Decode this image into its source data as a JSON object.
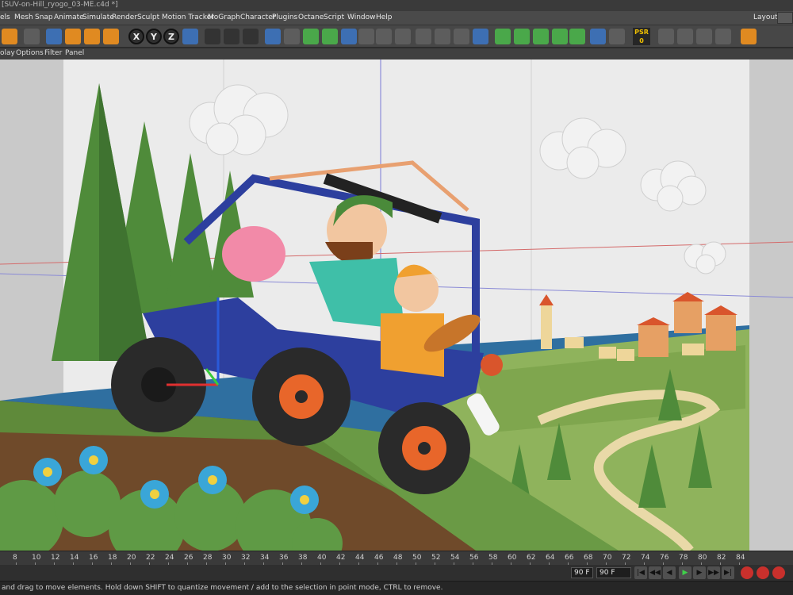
{
  "window": {
    "title": "[SUV-on-Hill_ryogo_03-ME.c4d *]"
  },
  "menu": {
    "items": [
      "els",
      "Mesh",
      "Snap",
      "Animate",
      "Simulate",
      "Render",
      "Sculpt",
      "Motion Tracker",
      "MoGraph",
      "Character",
      "Plugins",
      "Octane",
      "Script",
      "Window",
      "Help"
    ],
    "layout_label": "Layout:"
  },
  "toolbar": {
    "axis_x": "X",
    "axis_y": "Y",
    "axis_z": "Z",
    "psr_label": "PSR",
    "psr_value": "0",
    "icons": [
      "live-selection-icon",
      "move-icon",
      "scale-icon",
      "rotate-icon",
      "add-icon",
      "world-coordinates-icon",
      "render-view-icon",
      "render-picture-viewer-icon",
      "render-settings-icon",
      "cube-icon",
      "spline-icon",
      "nurbs-icon",
      "array-icon",
      "deformer-icon",
      "floor-icon",
      "camera-icon",
      "light-icon",
      "octane-camera-icon",
      "octane-light-icon",
      "sky-icon",
      "mograph-icon",
      "cloner-icon",
      "effector-icon",
      "tag-icon",
      "material-icon"
    ]
  },
  "view_menu": {
    "items": [
      "olay",
      "Options",
      "Filter",
      "Panel"
    ]
  },
  "timeline": {
    "ticks": [
      "8",
      "10",
      "12",
      "14",
      "16",
      "18",
      "20",
      "22",
      "24",
      "26",
      "28",
      "30",
      "32",
      "34",
      "36",
      "38",
      "40",
      "42",
      "44",
      "46",
      "48",
      "50",
      "52",
      "54",
      "56",
      "58",
      "60",
      "62",
      "64",
      "66",
      "68",
      "70",
      "72",
      "74",
      "76",
      "78",
      "80",
      "82",
      "84"
    ]
  },
  "playback": {
    "end_frame_a": "90 F",
    "end_frame_b": "90 F",
    "buttons": [
      "go-to-start-icon",
      "previous-key-icon",
      "previous-frame-icon",
      "play-icon",
      "next-frame-icon",
      "next-key-icon",
      "go-to-end-icon",
      "record-icon",
      "autokey-icon",
      "keyframe-selection-icon",
      "pla-icon"
    ]
  },
  "status": {
    "text": "and drag to move elements. Hold down SHIFT to quantize movement / add to the selection in point mode, CTRL to remove."
  },
  "colors": {
    "sky": "#ebebeb",
    "grass_light": "#8fb35c",
    "grass_dark": "#5f8a3a",
    "river": "#2f6fa0",
    "jeep_body": "#2d3f9e",
    "wheel_hub": "#e8662a",
    "tree": "#4f8b3a",
    "cloud": "#f2f2f2",
    "flower": "#3aa6d8"
  }
}
